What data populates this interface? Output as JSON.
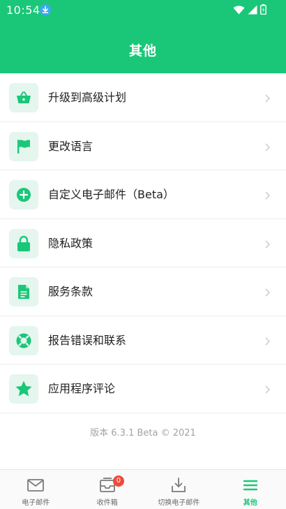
{
  "status_bar": {
    "time": "10:54",
    "icons": [
      "download-icon",
      "wifi-icon",
      "signal-icon",
      "battery-icon"
    ]
  },
  "header": {
    "title": "其他"
  },
  "menu": {
    "items": [
      {
        "label": "升级到高级计划",
        "icon": "basket-icon"
      },
      {
        "label": "更改语言",
        "icon": "flag-icon"
      },
      {
        "label": "自定义电子邮件（Beta）",
        "icon": "plus-circle-icon"
      },
      {
        "label": "隐私政策",
        "icon": "lock-icon"
      },
      {
        "label": "服务条款",
        "icon": "document-icon"
      },
      {
        "label": "报告错误和联系",
        "icon": "lifebuoy-icon"
      },
      {
        "label": "应用程序评论",
        "icon": "star-icon"
      }
    ]
  },
  "version_text": "版本 6.3.1 Beta © 2021",
  "bottom_nav": {
    "items": [
      {
        "label": "电子邮件",
        "icon": "mail-icon"
      },
      {
        "label": "收件箱",
        "icon": "inbox-icon",
        "badge": "0"
      },
      {
        "label": "切换电子邮件",
        "icon": "download-tray-icon"
      },
      {
        "label": "其他",
        "icon": "menu-icon",
        "active": true
      }
    ]
  },
  "colors": {
    "accent": "#1ac778",
    "icon_bg": "#e4f6ed",
    "badge": "#f04a3a"
  }
}
